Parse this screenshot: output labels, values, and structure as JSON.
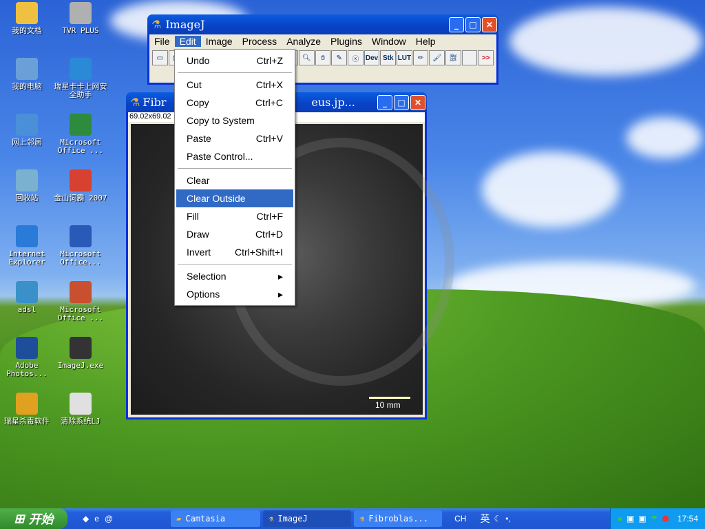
{
  "desktop": {
    "icons": [
      {
        "label": "我的文档",
        "icon": "folder-icon",
        "color": "#f0c040"
      },
      {
        "label": "TVR PLUS",
        "icon": "disc-icon",
        "color": "#b0b0b0"
      },
      {
        "label": "我的电脑",
        "icon": "computer-icon",
        "color": "#6aa0d8"
      },
      {
        "label": "瑞星卡卡上网安全助手",
        "icon": "kaka-icon",
        "color": "#2a8ad8"
      },
      {
        "label": "网上邻居",
        "icon": "network-icon",
        "color": "#4a90d8"
      },
      {
        "label": "Microsoft Office ...",
        "icon": "excel-icon",
        "color": "#2e8a3c"
      },
      {
        "label": "回收站",
        "icon": "recycle-bin-icon",
        "color": "#7ab0d0"
      },
      {
        "label": "金山词霸 2007",
        "icon": "dictionary-icon",
        "color": "#d84030"
      },
      {
        "label": "Internet Explorer",
        "icon": "ie-icon",
        "color": "#2a7ad8"
      },
      {
        "label": "Microsoft Office...",
        "icon": "word-icon",
        "color": "#2a5ab8"
      },
      {
        "label": "adsl",
        "icon": "adsl-icon",
        "color": "#3a90c8"
      },
      {
        "label": "Microsoft Office ...",
        "icon": "powerpoint-icon",
        "color": "#c85030"
      },
      {
        "label": "Adobe Photos...",
        "icon": "photoshop-icon",
        "color": "#1e4e9a"
      },
      {
        "label": "ImageJ.exe",
        "icon": "microscope-icon",
        "color": "#333333"
      },
      {
        "label": "瑞星杀毒软件",
        "icon": "rising-lion-icon",
        "color": "#e0a020"
      },
      {
        "label": "清除系统LJ",
        "icon": "cleaner-icon",
        "color": "#e0e0e0"
      }
    ]
  },
  "imagej": {
    "title": "ImageJ",
    "menus": [
      "File",
      "Edit",
      "Image",
      "Process",
      "Analyze",
      "Plugins",
      "Window",
      "Help"
    ],
    "active_menu": "Edit",
    "tools": [
      "rect",
      "oval",
      "",
      "",
      "",
      "",
      "",
      "",
      "",
      "magnifier",
      "hand",
      "dropper",
      "x",
      "Dev",
      "Stk",
      "LUT",
      "pencil",
      "brush",
      "fill",
      "",
      ">>"
    ]
  },
  "image_window": {
    "title_left": "Fibr",
    "title_right": "eus.jp...",
    "info": "69.02x69.02",
    "scale_bar": "10 mm"
  },
  "edit_menu": {
    "items": [
      {
        "label": "Undo",
        "shortcut": "Ctrl+Z"
      },
      {
        "sep": true
      },
      {
        "label": "Cut",
        "shortcut": "Ctrl+X"
      },
      {
        "label": "Copy",
        "shortcut": "Ctrl+C"
      },
      {
        "label": "Copy to System",
        "shortcut": ""
      },
      {
        "label": "Paste",
        "shortcut": "Ctrl+V"
      },
      {
        "label": "Paste Control...",
        "shortcut": ""
      },
      {
        "sep": true
      },
      {
        "label": "Clear",
        "shortcut": ""
      },
      {
        "label": "Clear Outside",
        "shortcut": "",
        "highlighted": true
      },
      {
        "label": "Fill",
        "shortcut": "Ctrl+F"
      },
      {
        "label": "Draw",
        "shortcut": "Ctrl+D"
      },
      {
        "label": "Invert",
        "shortcut": "Ctrl+Shift+I"
      },
      {
        "sep": true
      },
      {
        "label": "Selection",
        "shortcut": "▸"
      },
      {
        "label": "Options",
        "shortcut": "▸"
      }
    ]
  },
  "taskbar": {
    "start": "开始",
    "tasks": [
      {
        "label": "Camtasia"
      },
      {
        "label": "ImageJ",
        "active": true
      },
      {
        "label": "Fibroblas..."
      }
    ],
    "lang": "CH",
    "ime": "英",
    "clock": "17:54"
  }
}
